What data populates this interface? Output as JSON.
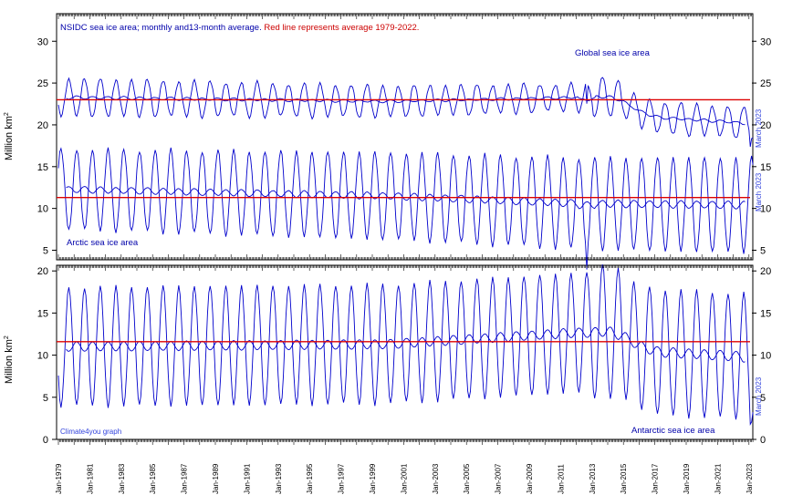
{
  "header": {
    "prefix": "NSIDC sea ice area; monthly and13-month average. ",
    "highlight": "Red line represents average 1979-2022."
  },
  "labels": {
    "global": "Global sea ice area",
    "arctic": "Arctic sea ice area",
    "antarctic": "Antarctic sea ice area",
    "credit": "Climate4you graph",
    "date_stamp": "March 2023",
    "ylabel": "Million km",
    "ylabel_sup": "2"
  },
  "colors": {
    "series": "#0000cc",
    "reference": "#dd0000",
    "header_blue": "#0000aa",
    "header_red": "#cc0000",
    "date_stamp": "#3344dd"
  },
  "chart_data": [
    {
      "type": "line",
      "panel": "top",
      "ylabel": "Million km²",
      "ylim": [
        5,
        30
      ],
      "y_ticks": [
        5,
        10,
        15,
        20,
        25,
        30
      ],
      "x_ticks": [
        "Jan-1979",
        "Jan-1981",
        "Jan-1983",
        "Jan-1985",
        "Jan-1987",
        "Jan-1989",
        "Jan-1991",
        "Jan-1993",
        "Jan-1995",
        "Jan-1997",
        "Jan-1999",
        "Jan-2001",
        "Jan-2003",
        "Jan-2005",
        "Jan-2007",
        "Jan-2009",
        "Jan-2011",
        "Jan-2013",
        "Jan-2015",
        "Jan-2017",
        "Jan-2019",
        "Jan-2021",
        "Jan-2023"
      ],
      "x_range": [
        "1979-01",
        "2023-03"
      ],
      "grid": false,
      "series": [
        {
          "name": "Global sea ice area",
          "monthly_profile": {
            "mean": 23.2,
            "amplitude": 4.1,
            "peak_month": "October",
            "trough_month": "February",
            "range_2016_2023": [
              16.5,
              24.5
            ]
          },
          "average_13_month": {
            "1979": 23.5,
            "2000": 23.0,
            "2014": 23.6,
            "2017": 21.0,
            "2023": 21.0
          },
          "reference_average_1979_2022": 23.0
        },
        {
          "name": "Arctic sea ice area",
          "monthly_profile": {
            "peak_month": "March",
            "trough_month": "September",
            "range_1979": [
              6.8,
              16.2
            ],
            "range_2022": [
              3.5,
              14.2
            ],
            "lowest": {
              "date": "2012-09",
              "value": 2.7
            }
          },
          "average_13_month": {
            "1979": 12.3,
            "2000": 11.5,
            "2012": 10.6,
            "2023": 10.4
          },
          "reference_average_1979_2022": 11.3
        }
      ]
    },
    {
      "type": "line",
      "panel": "bottom",
      "ylabel": "Million km²",
      "ylim": [
        0,
        20
      ],
      "y_ticks": [
        0,
        5,
        10,
        15,
        20
      ],
      "x_range": [
        "1979-01",
        "2023-03"
      ],
      "grid": false,
      "series": [
        {
          "name": "Antarctic sea ice area",
          "monthly_profile": {
            "peak_month": "September",
            "trough_month": "February",
            "range_1979": [
              3.0,
              16.4
            ],
            "max_2014": 19.7,
            "min_2023": 1.8
          },
          "average_13_month": {
            "1979": 11.0,
            "2000": 11.3,
            "2014": 12.9,
            "2017": 10.4,
            "2023": 9.8
          },
          "reference_average_1979_2022": 11.6
        }
      ]
    }
  ]
}
